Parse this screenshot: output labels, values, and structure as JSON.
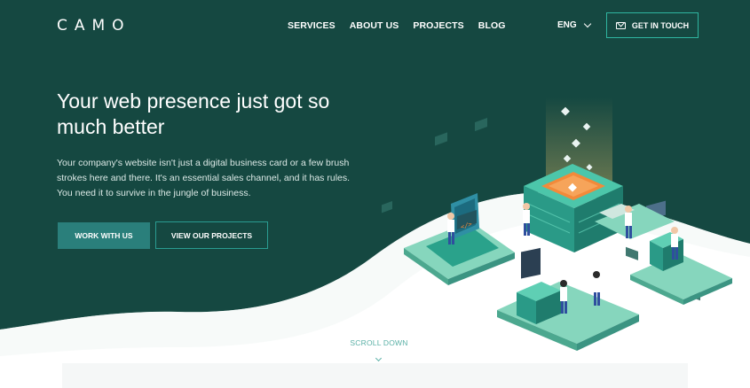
{
  "brand": {
    "logo": "CAMO"
  },
  "nav": {
    "items": [
      {
        "label": "SERVICES"
      },
      {
        "label": "ABOUT US"
      },
      {
        "label": "PROJECTS"
      },
      {
        "label": "BLOG"
      }
    ],
    "language": "ENG",
    "cta_label": "GET IN TOUCH"
  },
  "hero": {
    "headline": "Your web presence just got so much better",
    "description": "Your company's website isn't just a digital business card or a few brush strokes here and there. It's an essential sales channel, and it has rules. You need it to survive in the jungle of business.",
    "primary_button": "WORK WITH US",
    "secondary_button": "VIEW OUR PROJECTS",
    "scroll_label": "SCROLL DOWN"
  },
  "colors": {
    "background_dark": "#154841",
    "accent_teal": "#2fb5a0",
    "button_fill": "#2a7f7b",
    "highlight_orange": "#f28a3a"
  },
  "icons": [
    "mail-icon",
    "chevron-down-icon",
    "code-icon"
  ]
}
